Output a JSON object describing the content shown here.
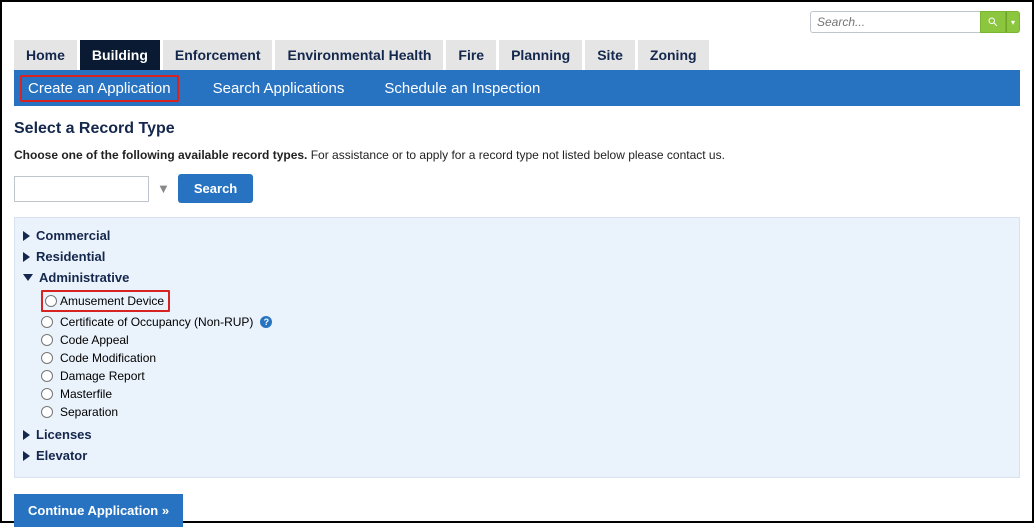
{
  "search": {
    "placeholder": "Search..."
  },
  "main_tabs": [
    {
      "label": "Home",
      "active": false
    },
    {
      "label": "Building",
      "active": true
    },
    {
      "label": "Enforcement",
      "active": false
    },
    {
      "label": "Environmental Health",
      "active": false
    },
    {
      "label": "Fire",
      "active": false
    },
    {
      "label": "Planning",
      "active": false
    },
    {
      "label": "Site",
      "active": false
    },
    {
      "label": "Zoning",
      "active": false
    }
  ],
  "subnav": {
    "create": "Create an Application",
    "search": "Search Applications",
    "schedule": "Schedule an Inspection"
  },
  "page_title": "Select a Record Type",
  "instruction_bold": "Choose one of the following available record types.",
  "instruction_rest": " For assistance or to apply for a record type not listed below please contact us.",
  "filter": {
    "search_button": "Search"
  },
  "categories": {
    "commercial": "Commercial",
    "residential": "Residential",
    "administrative": "Administrative",
    "administrative_items": {
      "amusement": "Amusement Device",
      "coo": "Certificate of Occupancy (Non-RUP)",
      "code_appeal": "Code Appeal",
      "code_mod": "Code Modification",
      "damage": "Damage Report",
      "masterfile": "Masterfile",
      "separation": "Separation"
    },
    "licenses": "Licenses",
    "elevator": "Elevator"
  },
  "continue_label": "Continue Application »"
}
